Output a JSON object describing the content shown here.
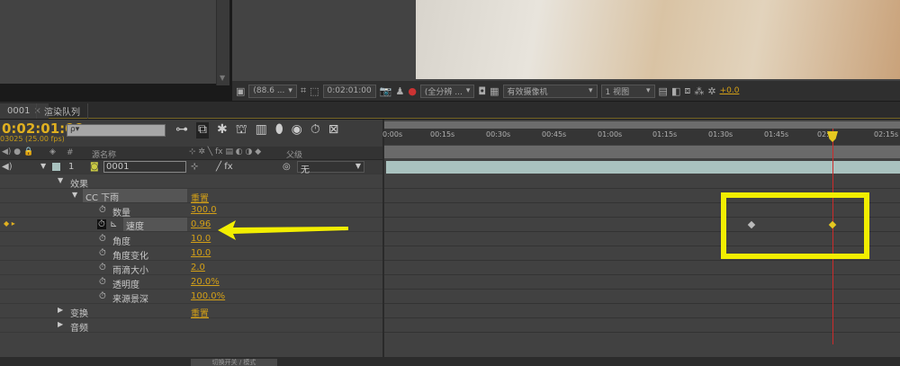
{
  "viewer": {
    "zoom": "(88.6 ...",
    "timecode": "0:02:01:00",
    "resolution": "(全分辨 ...",
    "camera": "有效摄像机",
    "views": "1 视图",
    "exposure": "+0.0"
  },
  "tabs": [
    {
      "label": "0001"
    },
    {
      "label": "渲染队列"
    }
  ],
  "comp": {
    "timecode": "0:02:01:00",
    "fps": "03025 (25.00 fps)",
    "search_placeholder": "ρ▾"
  },
  "columns": {
    "number": "#",
    "source_name": "源名称",
    "parent": "父级"
  },
  "layer": {
    "number": "1",
    "name": "0001",
    "parent": "无"
  },
  "tree": {
    "effects": "效果",
    "effect_name": "CC 下雨",
    "reset": "重置",
    "properties": [
      {
        "name": "数量",
        "value": "300.0"
      },
      {
        "name": "速度",
        "value": "0.96"
      },
      {
        "name": "角度",
        "value": "10.0"
      },
      {
        "name": "角度变化",
        "value": "10.0"
      },
      {
        "name": "雨滴大小",
        "value": "2.0"
      },
      {
        "name": "透明度",
        "value": "20.0%"
      },
      {
        "name": "来源景深",
        "value": "100.0%"
      }
    ],
    "transform": "变换",
    "transform_reset": "重置",
    "audio": "音频"
  },
  "ruler": [
    "0:00s",
    "00:15s",
    "00:30s",
    "00:45s",
    "01:00s",
    "01:15s",
    "01:30s",
    "01:45s",
    "02:",
    "02:15s"
  ],
  "bottom": {
    "toggle": "切换开关 / 模式"
  },
  "colors": {
    "accent": "#e0b020",
    "highlight": "#f2ee00",
    "playhead": "#cc2b2b",
    "layer_bar": "#a9c2bf"
  }
}
